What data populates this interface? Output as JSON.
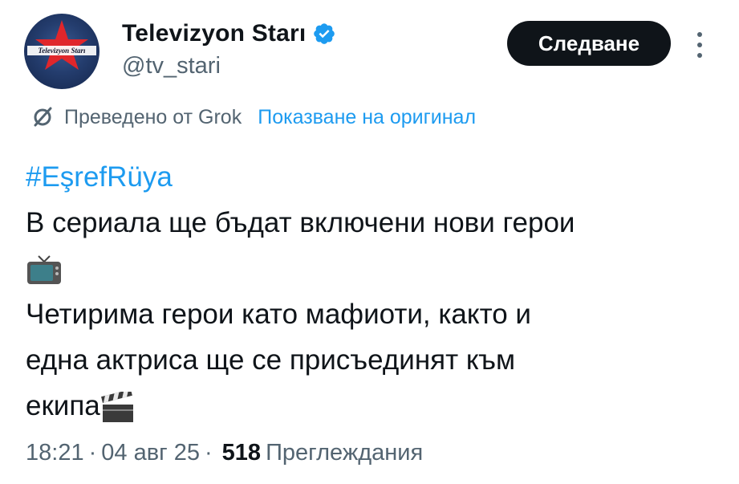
{
  "author": {
    "display_name": "Televizyon Starı",
    "handle": "@tv_stari",
    "avatar_logo_text": "Televizyon Starı",
    "verified": true
  },
  "actions": {
    "follow_label": "Следване"
  },
  "translation": {
    "label": "Преведено от Grok",
    "show_original_label": "Показване на оригинал"
  },
  "tweet": {
    "hashtag": "#EşrefRüya",
    "line1": "В сериала ще бъдат включени нови герои",
    "line1_emoji": "tv-icon",
    "line2": "Четирима герои като мафиоти, както и",
    "line3": "една актриса ще се присъединят към",
    "line4": "екипа",
    "line4_emoji": "clapperboard-icon"
  },
  "meta": {
    "time": "18:21",
    "date": "04 авг 25",
    "views_count": "518",
    "views_label": "Преглеждания"
  },
  "colors": {
    "accent": "#1d9bf0",
    "text": "#0f1419",
    "muted": "#536471",
    "button_bg": "#0f1419"
  }
}
